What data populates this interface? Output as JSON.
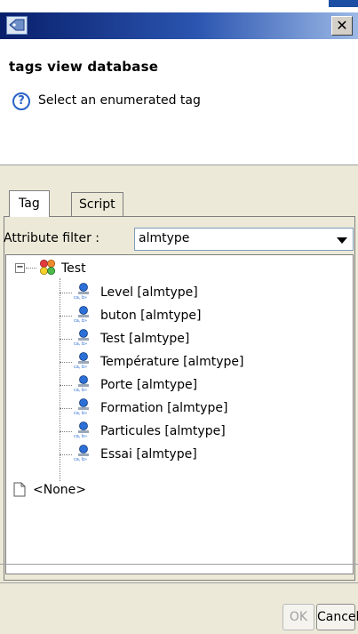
{
  "window": {
    "close_glyph": "✕"
  },
  "header": {
    "title": "tags view database",
    "help_glyph": "?",
    "message": "Select an enumerated tag"
  },
  "tabs": [
    {
      "label": "Tag",
      "active": true
    },
    {
      "label": "Script",
      "active": false
    }
  ],
  "filter": {
    "label": "Attribute filter :",
    "value": "almtype"
  },
  "tree": {
    "root": {
      "label": "Test",
      "expanded": true,
      "expander_glyph": "−"
    },
    "children": [
      {
        "label": "Level [almtype]"
      },
      {
        "label": "buton [almtype]"
      },
      {
        "label": "Test [almtype]"
      },
      {
        "label": "Température [almtype]"
      },
      {
        "label": "Porte [almtype]"
      },
      {
        "label": "Formation [almtype]"
      },
      {
        "label": "Particules [almtype]"
      },
      {
        "label": "Essai [almtype]"
      }
    ],
    "none_item": {
      "label": "<None>"
    }
  },
  "buttons": {
    "ok": "OK",
    "cancel": "Cancel"
  },
  "icons": {
    "window": "tag-window-icon",
    "group": "tag-group-icon",
    "item": "enumerated-tag-icon",
    "none": "blank-document-icon",
    "help": "help-icon",
    "dropdown": "chevron-down-icon"
  },
  "colors": {
    "title_bar_start": "#081f6b",
    "title_bar_end": "#9cb9e6",
    "dialog_background": "#ece9d8",
    "help_blue": "#2a62c7"
  }
}
